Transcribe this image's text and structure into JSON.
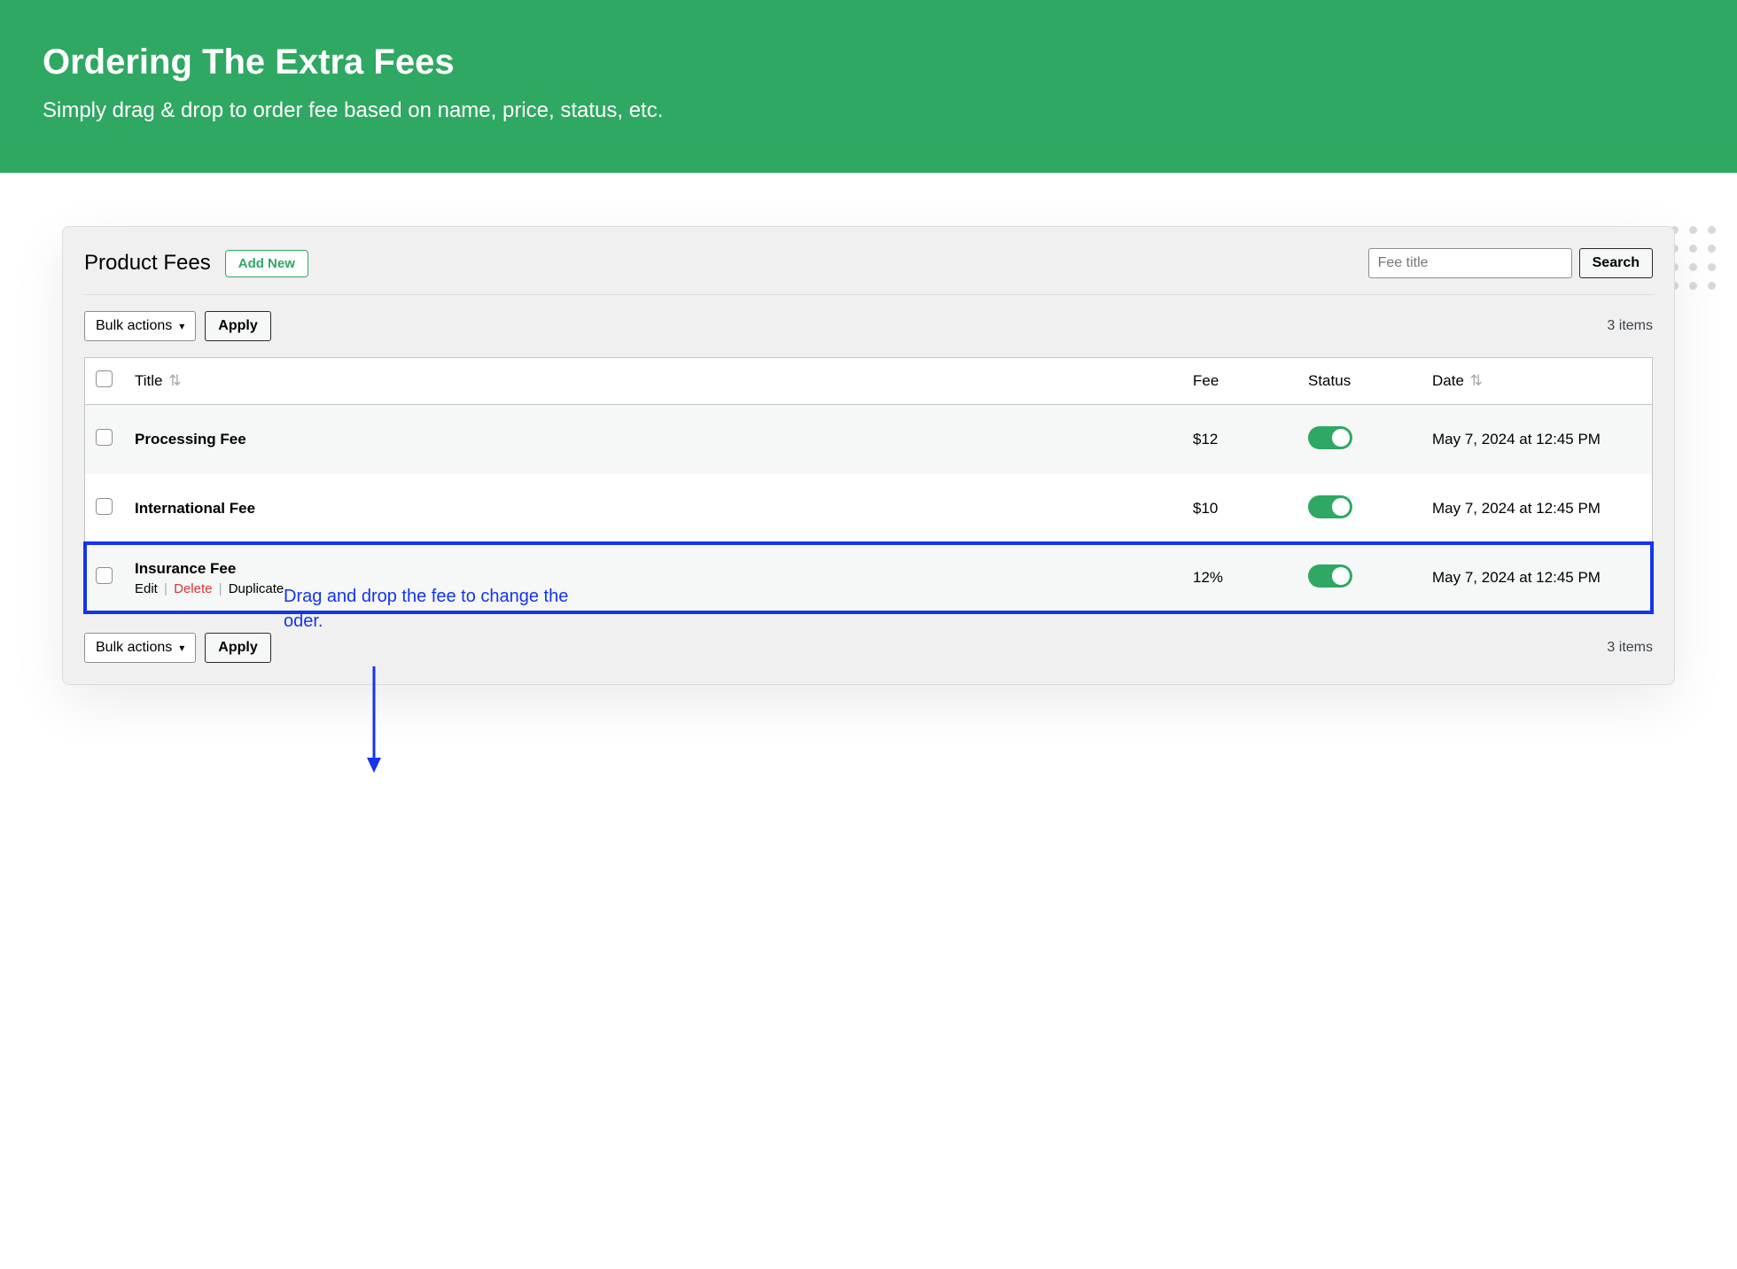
{
  "hero": {
    "title": "Ordering The Extra Fees",
    "subtitle": "Simply drag & drop to order fee based on name, price, status, etc."
  },
  "panel": {
    "title": "Product Fees",
    "add_label": "Add New",
    "search_placeholder": "Fee title",
    "search_button": "Search",
    "bulk_label": "Bulk actions",
    "apply_label": "Apply",
    "item_count": "3 items"
  },
  "table": {
    "headers": {
      "title": "Title",
      "fee": "Fee",
      "status": "Status",
      "date": "Date"
    },
    "rows": [
      {
        "title": "Processing Fee",
        "fee": "$12",
        "date": "May 7, 2024 at 12:45 PM"
      },
      {
        "title": "International Fee",
        "fee": "$10",
        "date": "May 7, 2024 at 12:45 PM"
      },
      {
        "title": "Insurance Fee",
        "fee": "12%",
        "date": "May 7, 2024 at 12:45 PM"
      }
    ]
  },
  "row_actions": {
    "edit": "Edit",
    "delete": "Delete",
    "duplicate": "Duplicate"
  },
  "annotation": {
    "text": "Drag and drop the fee to change the oder."
  }
}
